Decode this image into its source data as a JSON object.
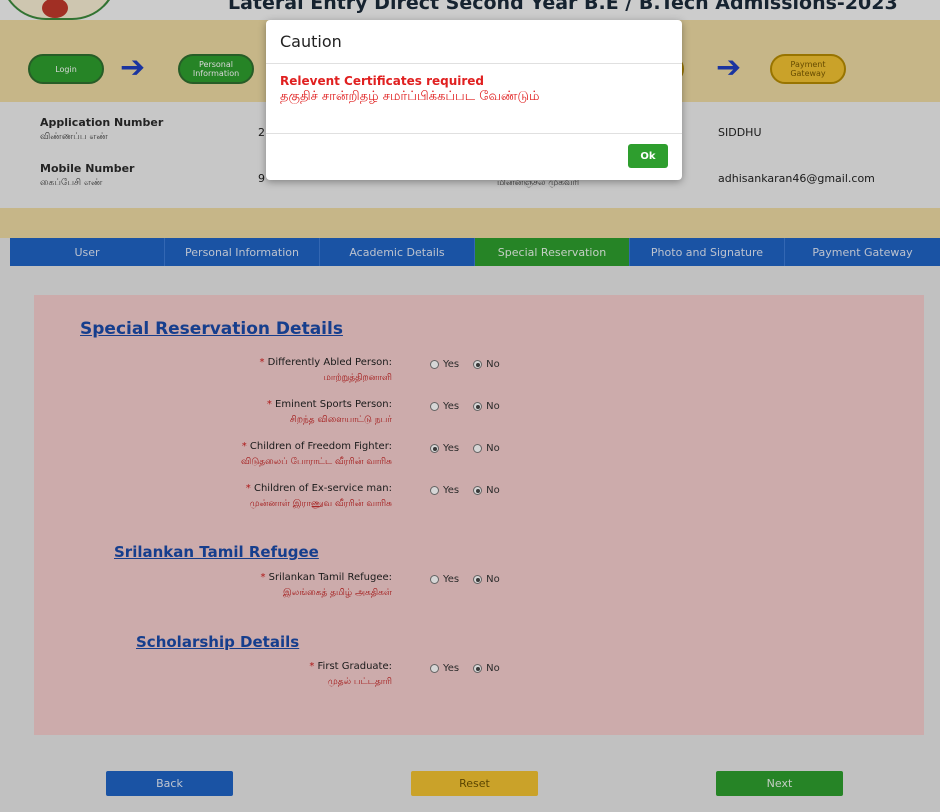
{
  "header": {
    "title": "Lateral Entry Direct Second Year B.E / B.Tech Admissions-2023"
  },
  "steps": [
    {
      "label": "Login",
      "color": "#2e9e2e"
    },
    {
      "label": "Personal Information",
      "color": "#2e9e2e"
    },
    {
      "label": "Payment Gateway",
      "color": "#f1c232"
    }
  ],
  "info": {
    "application_number_label": "Application Number",
    "application_number_label_ta": "விண்ணப்ப எண்",
    "application_number_value": "2",
    "mobile_number_label": "Mobile Number",
    "mobile_number_label_ta": "கைப்பேசி எண்",
    "mobile_number_value": "9",
    "email_label_ta": "மின்னஞ்சல் முகவரி",
    "name_value": "SIDDHU",
    "email_value": "adhisankaran46@gmail.com"
  },
  "tabs": [
    {
      "label": "User"
    },
    {
      "label": "Personal Information"
    },
    {
      "label": "Academic Details"
    },
    {
      "label": "Special Reservation",
      "active": true
    },
    {
      "label": "Photo and Signature"
    },
    {
      "label": "Payment Gateway"
    }
  ],
  "form": {
    "section_special": "Special Reservation Details",
    "section_refugee": "Srilankan Tamil Refugee",
    "section_scholarship": "Scholarship Details",
    "yes_label": "Yes",
    "no_label": "No",
    "questions": [
      {
        "en": "Differently Abled Person:",
        "ta": "மாற்றுத்திறனாளி",
        "selected": "No"
      },
      {
        "en": "Eminent Sports Person:",
        "ta": "சிறந்த விளையாட்டு நபர்",
        "selected": "No"
      },
      {
        "en": "Children of Freedom Fighter:",
        "ta": "விடுதலைப் போராட்ட வீரரின் வாரிசு",
        "selected": "Yes"
      },
      {
        "en": "Children of Ex-service man:",
        "ta": "முன்னாள் இராணுவ வீரரின் வாரிசு",
        "selected": "No"
      },
      {
        "en": "Srilankan Tamil Refugee:",
        "ta": "இலங்கைத் தமிழ் அகதிகள்",
        "selected": "No"
      },
      {
        "en": "First Graduate:",
        "ta": "முதல் பட்டதாரி",
        "selected": "No"
      }
    ]
  },
  "buttons": {
    "back": "Back",
    "reset": "Reset",
    "next": "Next"
  },
  "modal": {
    "title": "Caution",
    "message_en": "Relevent Certificates required",
    "message_ta": "தகுதிச் சான்றிதழ் சமர்ப்பிக்கப்பட வேண்டும்",
    "ok_label": "Ok"
  },
  "colors": {
    "primary_blue": "#1f63c4",
    "success_green": "#2e9e2e",
    "warning_yellow": "#f1c232",
    "card_pink": "#f3cccc",
    "error_red": "#e02020"
  }
}
